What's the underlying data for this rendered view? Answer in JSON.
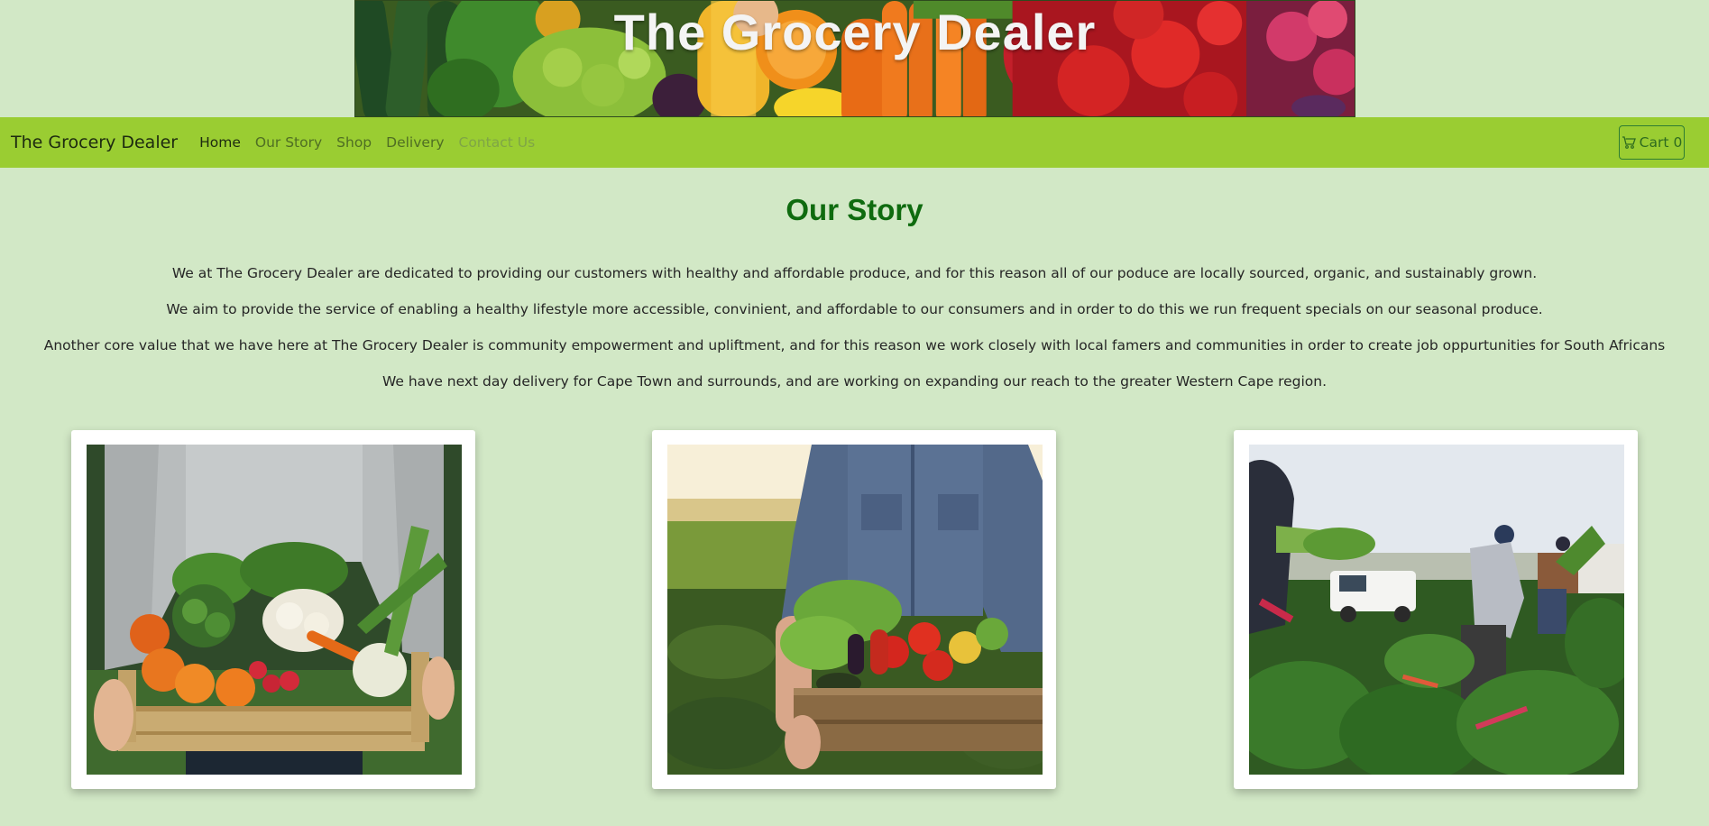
{
  "banner": {
    "title": "The Grocery Dealer"
  },
  "navbar": {
    "brand": "The Grocery Dealer",
    "links": [
      "Home",
      "Our Story",
      "Shop",
      "Delivery",
      "Contact Us"
    ],
    "cart_label": "Cart",
    "cart_count": "0"
  },
  "story": {
    "title": "Our Story",
    "paragraphs": [
      "We at The Grocery Dealer are dedicated to providing our customers with healthy and affordable produce, and for this reason all of our poduce are locally sourced, organic, and sustainably grown.",
      "We aim to provide the service of enabling a healthy lifestyle more accessible, convinient, and affordable to our consumers and in order to do this we run frequent specials on our seasonal produce.",
      "Another core value that we have here at The Grocery Dealer is community empowerment and upliftment, and for this reason we work closely with local famers and communities in order to create job oppurtunities for South Africans",
      "We have next day delivery for Cape Town and surrounds, and are working on expanding our reach to the greater Western Cape region."
    ]
  },
  "colors": {
    "page_bg": "#d2e8c6",
    "navbar_bg": "#9acd32",
    "title_green": "#0f6b0f"
  }
}
